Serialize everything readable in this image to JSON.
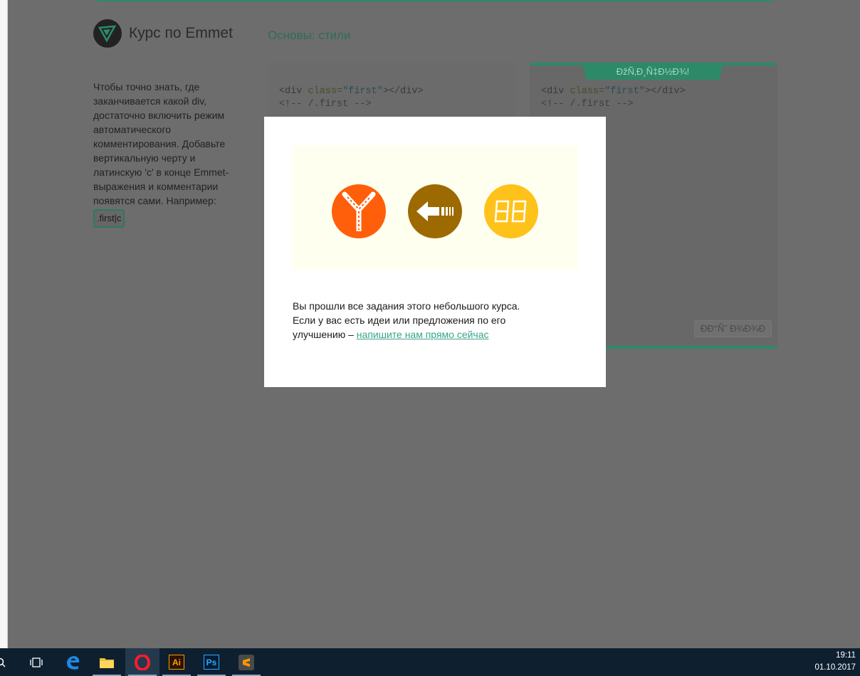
{
  "header": {
    "course_title": "Курс по Emmet",
    "section_title": "Основы: стили"
  },
  "description": {
    "text": "Чтобы точно знать, где заканчивается какой div, достаточно включить режим автоматического комментирования. Добавьте вертикальную черту и латинскую 'с' в конце Emmet-выражения и комментарии появятся сами. Например:",
    "example_code": ".first|c"
  },
  "editor": {
    "line1_open": "<div ",
    "line1_attr": "class=",
    "line1_str": "\"first\"",
    "line1_close": "></div>",
    "line2": "<!-- /.first -->"
  },
  "result": {
    "tab_label": "ÐžÑ‚Ð¸Ñ‡Ð½Ð¾!",
    "line1_open": "<div ",
    "line1_attr": "class=",
    "line1_str": "\"first\"",
    "line1_close": "></div>",
    "line2": "<!-- /.first -->",
    "check_button": "ÐÐ°Ñ˜ Ð¾Ð¾Ð"
  },
  "modal": {
    "badges": [
      "yggdrasil-badge-icon",
      "arrow-badge-icon",
      "digits-badge-icon"
    ],
    "line1": "Вы прошли все задания этого небольшого курса.",
    "line2": "Если у вас есть идеи или предложения по его",
    "line3_prefix": "улучшению – ",
    "link_text": "напишите нам прямо сейчас"
  },
  "colors": {
    "accent": "#2c8a68",
    "badge_orange": "#ff5f0a",
    "badge_brown": "#9c6a00",
    "badge_yellow": "#ffc21a",
    "link": "#3aa38a"
  },
  "taskbar": {
    "items": [
      "search-icon",
      "task-view-icon",
      "edge-icon",
      "file-explorer-icon",
      "opera-icon",
      "illustrator-icon",
      "photoshop-icon",
      "sublime-text-icon"
    ],
    "illustrator_label": "Ai",
    "photoshop_label": "Ps",
    "time": "19:11",
    "date": "01.10.2017"
  }
}
